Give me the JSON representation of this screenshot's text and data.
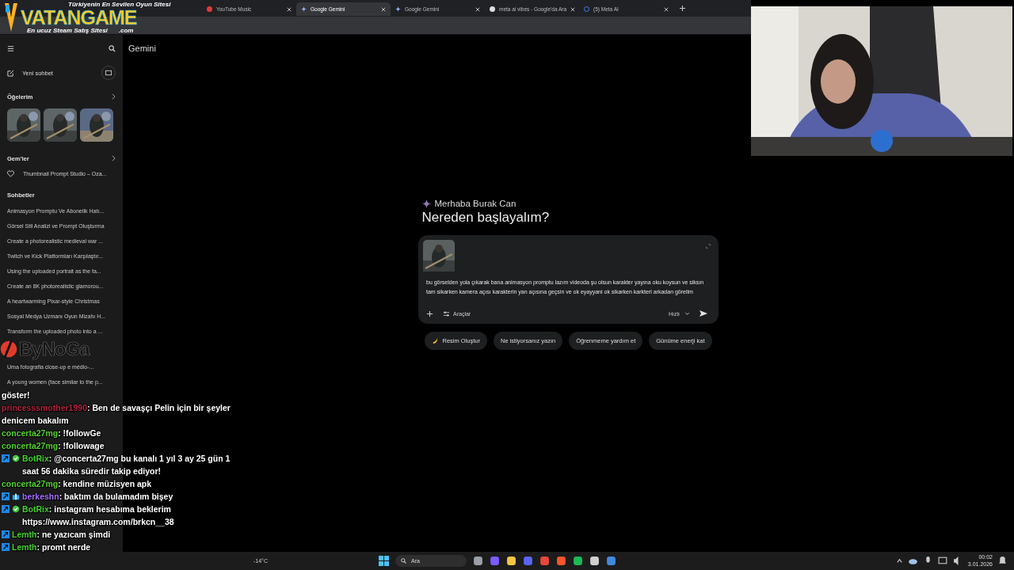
{
  "browser": {
    "tabs": [
      {
        "title": "YouTube Music",
        "selected": false
      },
      {
        "title": "Google Gemini",
        "selected": true
      },
      {
        "title": "Google Gemini",
        "selected": false
      },
      {
        "title": "meta ai vibes - Google'da Ara",
        "selected": false
      },
      {
        "title": "(5) Meta AI",
        "selected": false
      }
    ]
  },
  "sponsor_banner": {
    "tagline": "Türkiyenin En Sevilen Oyun Sitesi",
    "brand": "VATANGAME",
    "subline": "En ucuz Steam Satış Sitesi",
    "domain": ".com"
  },
  "sidebar": {
    "new_chat": "Yeni sohbet",
    "my_items": {
      "title": "Öğelerim"
    },
    "gems": {
      "title": "Gem'ler",
      "items": [
        "Thumbnail Prompt Studio – Oza..."
      ]
    },
    "chats": {
      "title": "Sohbetler",
      "items": [
        "Animasyon Promptu Ve Abonelik Hatı...",
        "Görsel Stil Analizi ve Prompt Oluşturma",
        "Create a photorealistic medieval war ...",
        "Twitch ve Kick Platformları Karşılaştır...",
        "Using the uploaded portrait as the fa...",
        "Create an 8K photorealistic glamorou...",
        "A heartwarming Pixar-style Christmas",
        "Sosyal Medya Uzmanı Oyun Mizahı H...",
        "Transform the uploaded photo into a ...",
        "Uma fotografia close-up e médio-...",
        "A young women (face similar to the p..."
      ]
    }
  },
  "stream_logo": "ByNoGa",
  "main": {
    "app_title": "Gemini",
    "greeting": "Merhaba Burak Can",
    "headline": "Nereden başlayalım?",
    "prompt": {
      "value": "bu görselden yola çıkarak bana animasyon promptu lazım videoda şu olsun karakter yayına oku koysun ve siksın tam sikarken kamera açısı karakterin yan açısına geçsin ve ok eyayyani ok sikarken karkteri arkadan görelim",
      "tools": "Araçlar",
      "mode": "Hızlı"
    },
    "suggestions": [
      "Resim Oluştur",
      "Ne istiyorsanız yazın",
      "Öğrenmeme yardım et",
      "Günüme enerji kat"
    ]
  },
  "chat": [
    {
      "kind": "plain",
      "color": "#ffffff",
      "text": "göster!"
    },
    {
      "kind": "viewer",
      "user": "princesssmother1990",
      "color": "#b3213f",
      "text": ": Ben de savaşçı Pelin için bir şeyler denicem bakalım"
    },
    {
      "kind": "viewer",
      "user": "concerta27mg",
      "color": "#53d12c",
      "text": ": !followGe"
    },
    {
      "kind": "viewer",
      "user": "concerta27mg",
      "color": "#53d12c",
      "text": ": !followage"
    },
    {
      "kind": "bot",
      "user": "BotRix",
      "color": "#45d22e",
      "text": ": @concerta27mg bu kanalı 1 yıl 3 ay 25 gün 1 saat 56 dakika süredir takip ediyor!"
    },
    {
      "kind": "viewer",
      "user": "concerta27mg",
      "color": "#53d12c",
      "text": ": kendine müzisyen apk"
    },
    {
      "kind": "gifter",
      "user": "berkeshn",
      "color": "#a66cff",
      "text": ": baktım da bulamadım bişey"
    },
    {
      "kind": "bot",
      "user": "BotRix",
      "color": "#45d22e",
      "text": ": instagram hesabıma beklerim https://www.instagram.com/brkcn__38"
    },
    {
      "kind": "member",
      "user": "Lemth",
      "color": "#45d22e",
      "text": ": ne yazıcam şimdi"
    },
    {
      "kind": "member",
      "user": "Lemth",
      "color": "#45d22e",
      "text": ": promt nerde"
    }
  ],
  "taskbar": {
    "weather": "-14°C",
    "search_placeholder": "Ara",
    "time": "00:02",
    "date": "3.01.2026"
  }
}
